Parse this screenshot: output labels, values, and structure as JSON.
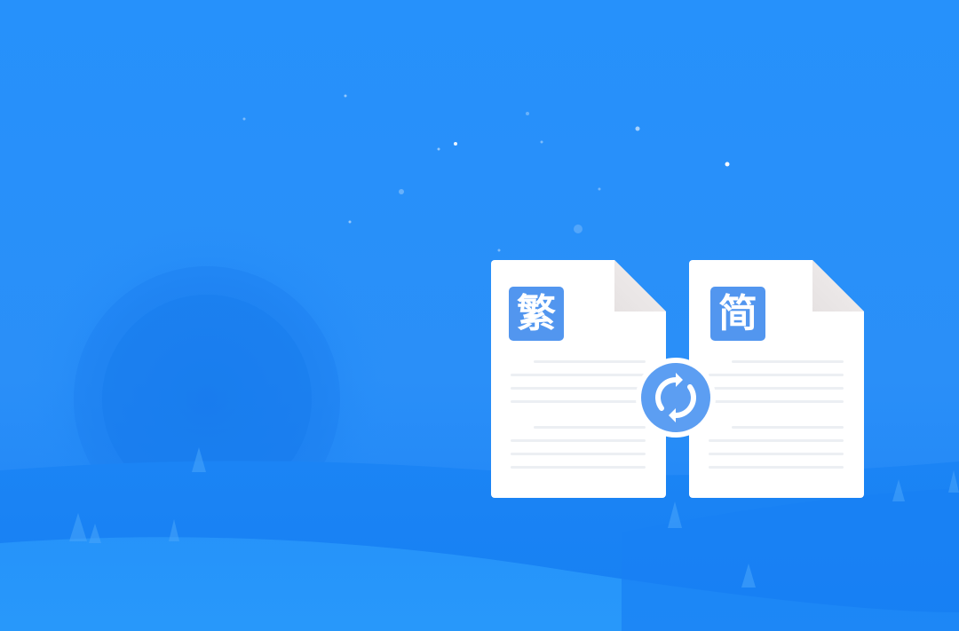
{
  "colors": {
    "background": "#2691fb",
    "document": "#ffffff",
    "badge": "#5296ef",
    "swap_button": "#5c9ef2"
  },
  "traditional_document": {
    "character": "繁",
    "icon": "document-icon"
  },
  "simplified_document": {
    "character": "简",
    "icon": "document-icon"
  },
  "convert_button": {
    "icon": "refresh-swap-icon"
  }
}
